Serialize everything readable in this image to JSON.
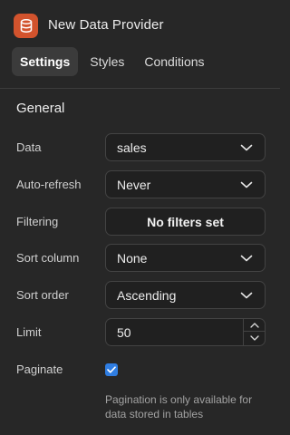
{
  "header": {
    "title": "New Data Provider",
    "icon": "database-icon",
    "accent": "#d2532d"
  },
  "tabs": [
    {
      "label": "Settings",
      "active": true
    },
    {
      "label": "Styles",
      "active": false
    },
    {
      "label": "Conditions",
      "active": false
    }
  ],
  "section": {
    "title": "General"
  },
  "form": {
    "data": {
      "label": "Data",
      "value": "sales"
    },
    "auto_refresh": {
      "label": "Auto-refresh",
      "value": "Never"
    },
    "filtering": {
      "label": "Filtering",
      "value": "No filters set"
    },
    "sort_column": {
      "label": "Sort column",
      "value": "None"
    },
    "sort_order": {
      "label": "Sort order",
      "value": "Ascending"
    },
    "limit": {
      "label": "Limit",
      "value": "50"
    },
    "paginate": {
      "label": "Paginate",
      "checked": true,
      "hint": "Pagination is only available for data stored in tables"
    }
  },
  "colors": {
    "checkbox": "#2f7de1",
    "background": "#272727"
  }
}
